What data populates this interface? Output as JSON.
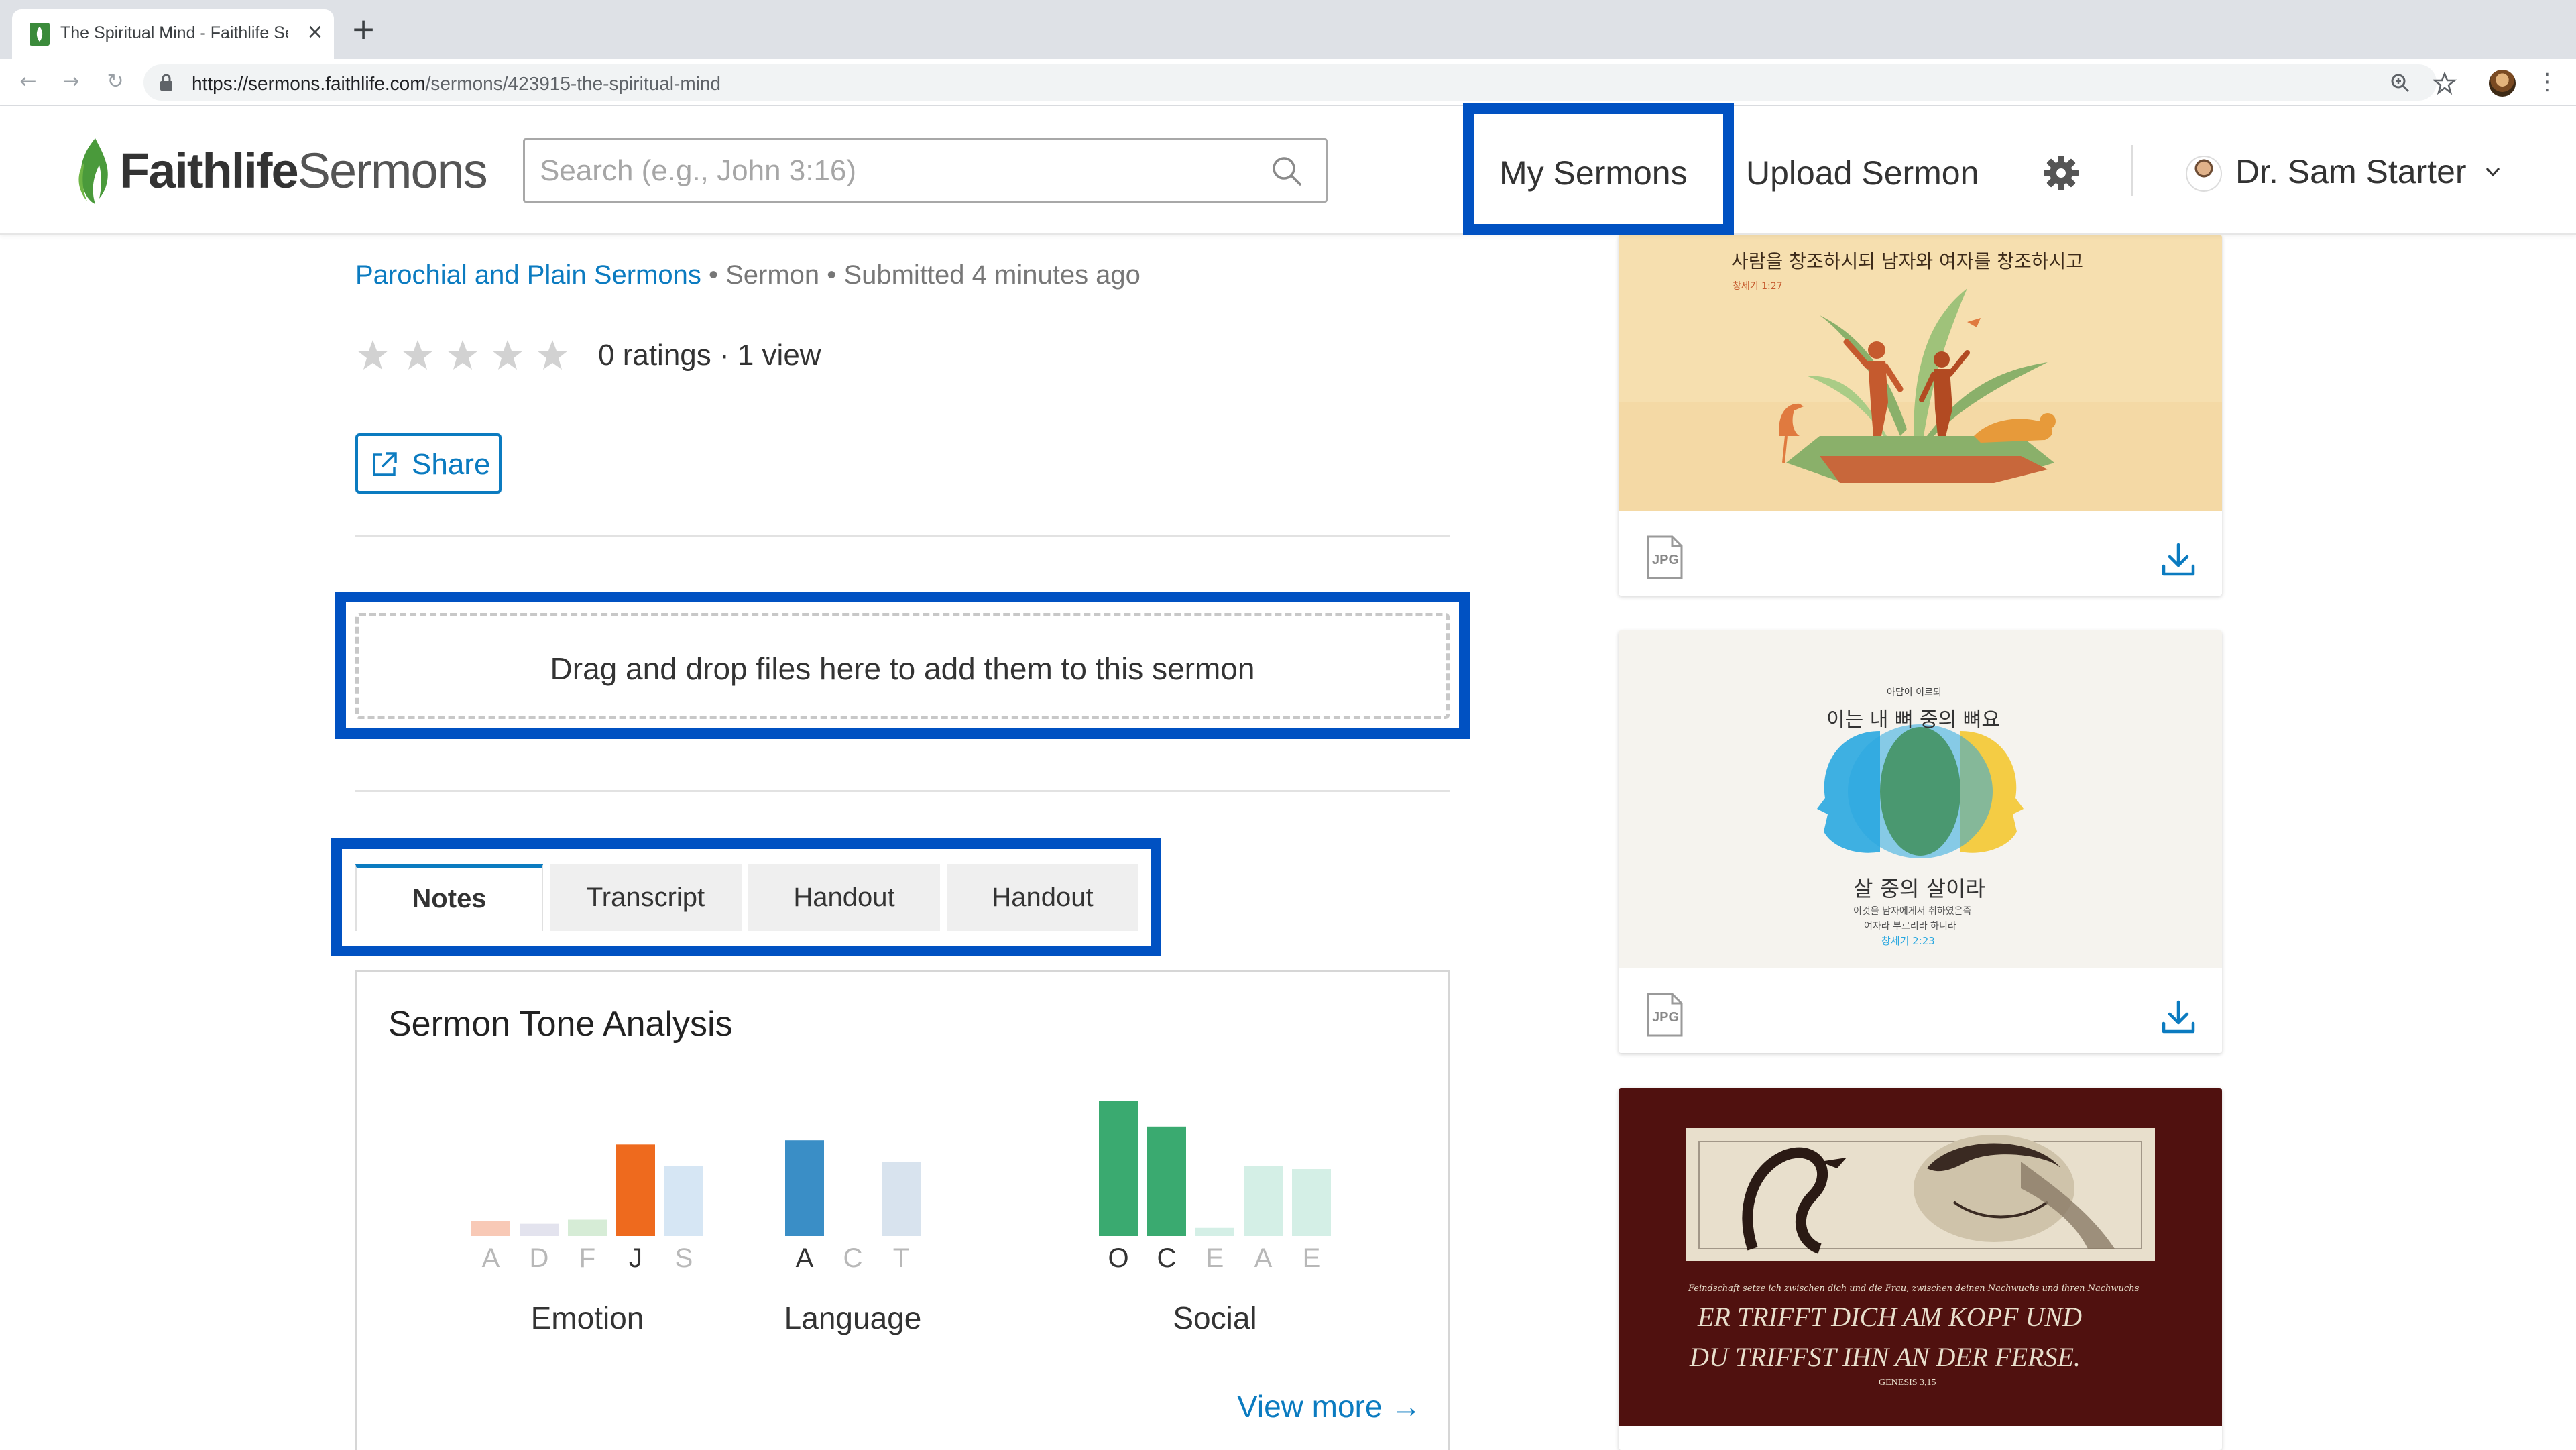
{
  "browser": {
    "tab_title": "The Spiritual Mind - Faithlife Se",
    "url_host": "https://sermons.faithlife.com",
    "url_path": "/sermons/423915-the-spiritual-mind"
  },
  "header": {
    "logo_part1": "Faithlife",
    "logo_part2": "Sermons",
    "search_placeholder": "Search (e.g., John 3:16)",
    "my_sermons": "My Sermons",
    "upload_sermon": "Upload Sermon",
    "user_name": "Dr. Sam Starter"
  },
  "sermon": {
    "series": "Parochial and Plain Sermons",
    "sep1": "•",
    "type": "Sermon",
    "sep2": "•",
    "submitted": "Submitted 4 minutes ago",
    "rating_stars": 0,
    "ratings_text": "0 ratings · 1 view",
    "share_label": "Share",
    "dropzone_text": "Drag and drop files here to add them to this sermon"
  },
  "tabs": [
    {
      "label": "Notes"
    },
    {
      "label": "Transcript"
    },
    {
      "label": "Handout"
    },
    {
      "label": "Handout"
    }
  ],
  "tone": {
    "title": "Sermon Tone Analysis",
    "view_more": "View more →"
  },
  "chart_data": {
    "type": "bar",
    "title": "Sermon Tone Analysis",
    "ylim": [
      0,
      1
    ],
    "groups": [
      {
        "name": "Emotion",
        "categories": [
          "A",
          "D",
          "F",
          "J",
          "S"
        ],
        "values": [
          0.11,
          0.09,
          0.12,
          0.67,
          0.51
        ],
        "colors": [
          "#f8c9b6",
          "#e3e3ee",
          "#d6ecd6",
          "#ee6a1e",
          "#d6e6f4"
        ],
        "dominant": [
          false,
          false,
          false,
          true,
          false
        ]
      },
      {
        "name": "Language",
        "categories": [
          "A",
          "C",
          "T"
        ],
        "values": [
          0.7,
          0.0,
          0.54
        ],
        "colors": [
          "#3a8ec6",
          "#e3e3ee",
          "#d8e3ee"
        ],
        "dominant": [
          true,
          false,
          false
        ]
      },
      {
        "name": "Social",
        "categories": [
          "O",
          "C",
          "E",
          "A",
          "E"
        ],
        "values": [
          0.99,
          0.8,
          0.06,
          0.51,
          0.49
        ],
        "colors": [
          "#3aaa70",
          "#3aaa70",
          "#d4efe6",
          "#d4efe6",
          "#d4efe6"
        ],
        "dominant": [
          true,
          true,
          false,
          false,
          false
        ]
      }
    ]
  },
  "art": [
    {
      "type": "JPG",
      "caption_line1": "사람을 창조하시되 남자와 여자를 창조하시고",
      "caption_line2": "창세기 1:27",
      "colors": {
        "bg": "#f6dfaf",
        "figure": "#c55a2e",
        "leaf": "#8ab06a"
      }
    },
    {
      "type": "JPG",
      "caption_top_small": "아담이 이르되",
      "caption_top": "이는 내 뼈 중의 뼈요",
      "caption_bottom": "살 중의 살이라",
      "caption_bottom_small1": "이것을 남자에게서 취하였은즉",
      "caption_bottom_small2": "여자라 부르리라 하니라",
      "caption_ref": "창세기 2:23",
      "colors": {
        "bg": "#f5f3ee",
        "blue": "#2aa8e0",
        "yellow": "#f3c93a",
        "green": "#3f8f5a"
      }
    },
    {
      "caption_small": "Feindschaft setze ich zwischen dich und die Frau, zwischen deinen Nachwuchs und ihren Nachwuchs",
      "caption_line1": "ER TRIFFT DICH AM KOPF UND",
      "caption_line2": "DU TRIFFST IHN AN DER FERSE.",
      "caption_ref": "GENESIS 3,15",
      "colors": {
        "bg": "#5c1512",
        "panel": "#e8dfcc"
      }
    }
  ],
  "colors": {
    "brand_blue": "#0b7bc0",
    "highlight": "#0051c2",
    "logo_green": "#4a9a3b"
  }
}
